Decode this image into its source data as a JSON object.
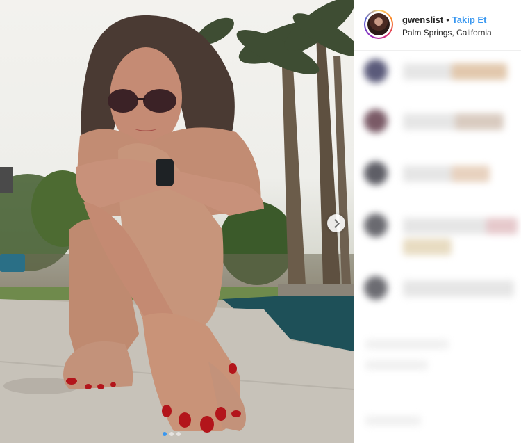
{
  "header": {
    "username": "gwenslist",
    "separator": "•",
    "follow_label": "Takip Et",
    "location": "Palm Springs, California"
  },
  "carousel": {
    "dot_count": 3,
    "active_index": 0
  },
  "icons": {
    "next": "chevron-right-icon",
    "avatar": "profile-avatar"
  },
  "colors": {
    "link_blue": "#3897f0",
    "text_dark": "#262626",
    "border": "#efefef"
  }
}
